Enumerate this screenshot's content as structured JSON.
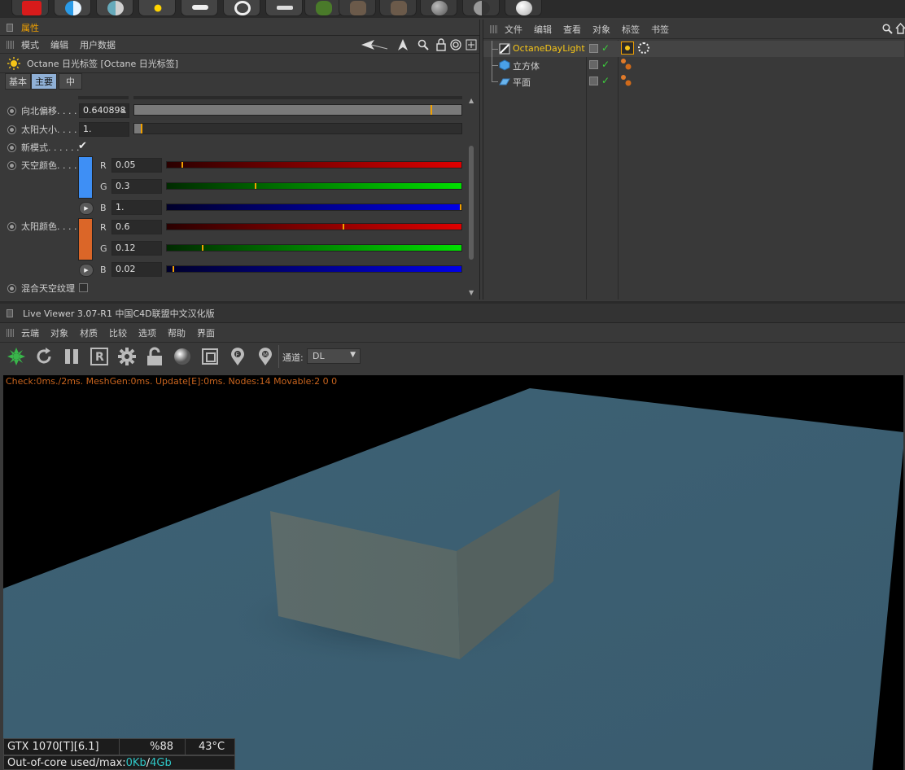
{
  "toolbar": {
    "icons": [
      "render-view-icon",
      "octane-sphere-icon",
      "half-sphere-icon",
      "sun-light-icon",
      "area-light-icon",
      "target-icon",
      "light-glow-icon",
      "plant-icon",
      "tree-icon",
      "tree2-icon",
      "sphere-material-icon",
      "dark-sphere-icon",
      "white-sphere-icon"
    ]
  },
  "attributes": {
    "panel_title": "属性",
    "menu": [
      "模式",
      "编辑",
      "用户数据"
    ],
    "object_title": "Octane 日光标签 [Octane 日光标签]",
    "tabs": [
      "基本",
      "主要",
      "中"
    ],
    "active_tab": "主要",
    "fields": {
      "north_offset": {
        "label": "向北偏移. . . .",
        "value": "0.640898",
        "level": 0.91
      },
      "sun_size": {
        "label": "太阳大小. . . .",
        "value": "1.",
        "level": 0.02
      },
      "new_model": {
        "label": "新模式. . . . . .",
        "checked": true
      },
      "sky_color": {
        "label": "天空颜色. . . .",
        "swatch": "#3e8ff5",
        "r": "0.05",
        "g": "0.3",
        "b": "1.",
        "r_level": 0.05,
        "g_level": 0.3,
        "b_level": 1.0
      },
      "sun_color": {
        "label": "太阳颜色. . . .",
        "swatch": "#db6628",
        "r": "0.6",
        "g": "0.12",
        "b": "0.02",
        "r_level": 0.6,
        "g_level": 0.12,
        "b_level": 0.02
      },
      "mix_sky": {
        "label": "混合天空纹理",
        "checked": false
      }
    },
    "channel_labels": {
      "r": "R",
      "g": "G",
      "b": "B"
    }
  },
  "object_manager": {
    "menu": [
      "文件",
      "编辑",
      "查看",
      "对象",
      "标签",
      "书签"
    ],
    "objects": [
      {
        "name": "OctaneDayLight",
        "color": "#f5c518",
        "icon": "daylight-icon"
      },
      {
        "name": "立方体",
        "color": "#cfcfcf",
        "icon": "cube-icon"
      },
      {
        "name": "平面",
        "color": "#cfcfcf",
        "icon": "plane-icon"
      }
    ]
  },
  "live_viewer": {
    "title": "Live Viewer 3.07-R1 中国C4D联盟中文汉化版",
    "menu": [
      "云端",
      "对象",
      "材质",
      "比较",
      "选项",
      "帮助",
      "界面"
    ],
    "channel_label": "通道:",
    "channel_value": "DL",
    "stats_line": "Check:0ms./2ms. MeshGen:0ms. Update[E]:0ms. Nodes:14 Movable:2  0 0",
    "gpu": "GTX 1070[T][6.1]",
    "usage": "%88",
    "temp": "43°C",
    "out_of_core_label": "Out-of-core used/max:",
    "out_of_core_used": "0Kb",
    "out_of_core_sep": "/",
    "out_of_core_max": "4Gb"
  },
  "colors": {
    "accent_orange": "#f0a000",
    "highlight_yellow": "#f5c518",
    "stats_orange": "#c8641e",
    "floor": "#3d5f72",
    "ooc_cyan": "#2fc6c6"
  }
}
